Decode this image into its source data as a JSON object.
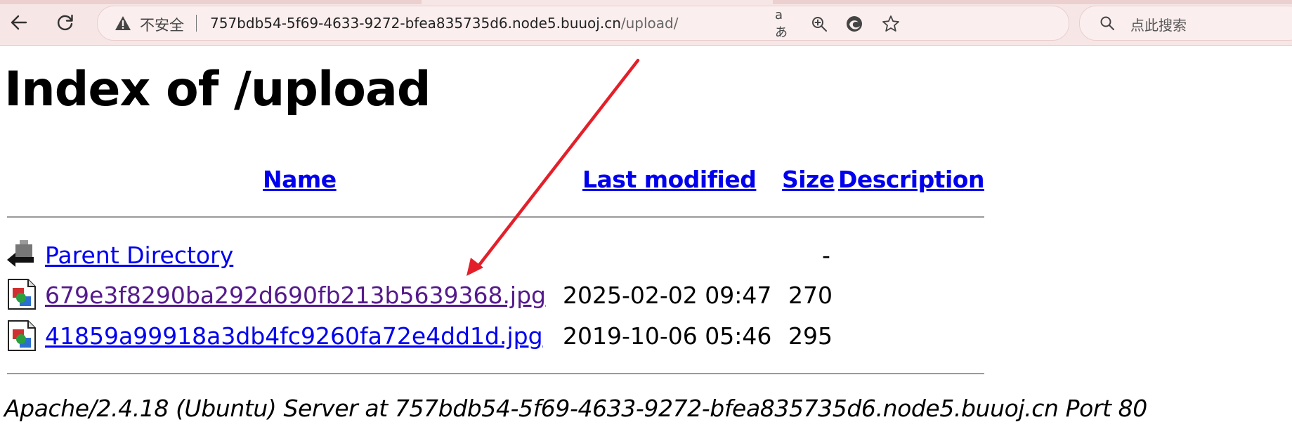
{
  "browser": {
    "back_icon": "arrow-left-icon",
    "reload_icon": "reload-icon",
    "security_icon": "warning-triangle-icon",
    "security_label": "不安全",
    "url_host": "757bdb54-5f69-4633-9272-bfea835735d6.node5.buuoj.cn",
    "url_path": "/upload/",
    "translate_label": "aあ",
    "zoom_icon": "zoom-in-icon",
    "edge_icon": "edge-logo-icon",
    "favorite_icon": "star-icon",
    "search_icon": "search-icon",
    "search_placeholder": "点此搜索"
  },
  "page": {
    "title": "Index of /upload",
    "columns": {
      "name": "Name",
      "last_modified": "Last modified",
      "size": "Size",
      "description": "Description"
    },
    "parent": {
      "icon": "back-folder-icon",
      "label": "Parent Directory",
      "size": "-"
    },
    "files": [
      {
        "icon": "image-file-icon",
        "name": "679e3f8290ba292d690fb213b5639368.jpg",
        "modified": "2025-02-02 09:47",
        "size": "270",
        "visited": true
      },
      {
        "icon": "image-file-icon",
        "name": "41859a99918a3db4fc9260fa72e4dd1d.jpg",
        "modified": "2019-10-06 05:46",
        "size": "295",
        "visited": false
      }
    ],
    "footer": "Apache/2.4.18 (Ubuntu) Server at 757bdb54-5f69-4633-9272-bfea835735d6.node5.buuoj.cn Port 80"
  },
  "annotation": {
    "arrow_color": "#e3202a",
    "arrow_icon": "red-arrow-annotation"
  },
  "colors": {
    "link": "#0000ee",
    "visited": "#551a8b",
    "chrome_bg": "#f7e6e6"
  }
}
